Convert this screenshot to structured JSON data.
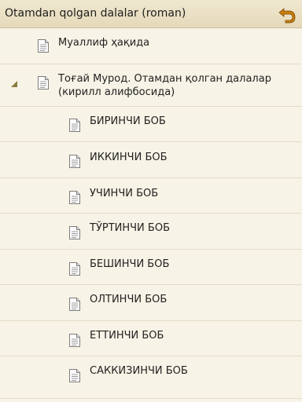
{
  "app": {
    "title": "Otamdan qolgan dalalar (roman)",
    "accent_color": "#c97d0b",
    "back_icon": "undo-arrow-icon"
  },
  "list": {
    "items": [
      {
        "label": "Муаллиф ҳақида",
        "icon": "document-icon"
      },
      {
        "label": "Тоғай Мурод. Отамдан қолган далалар (кирилл алифбосида)",
        "icon": "document-icon",
        "expanded": true,
        "expander_icon": "expanded-triangle-icon"
      },
      {
        "label": "БИРИНЧИ БОБ",
        "icon": "document-icon"
      },
      {
        "label": "ИККИНЧИ БОБ",
        "icon": "document-icon"
      },
      {
        "label": "УЧИНЧИ БОБ",
        "icon": "document-icon"
      },
      {
        "label": "ТЎРТИНЧИ БОБ",
        "icon": "document-icon"
      },
      {
        "label": "БЕШИНЧИ БОБ",
        "icon": "document-icon"
      },
      {
        "label": "ОЛТИНЧИ БОБ",
        "icon": "document-icon"
      },
      {
        "label": "ЕТТИНЧИ БОБ",
        "icon": "document-icon"
      },
      {
        "label": "САККИЗИНЧИ БОБ",
        "icon": "document-icon"
      }
    ]
  }
}
